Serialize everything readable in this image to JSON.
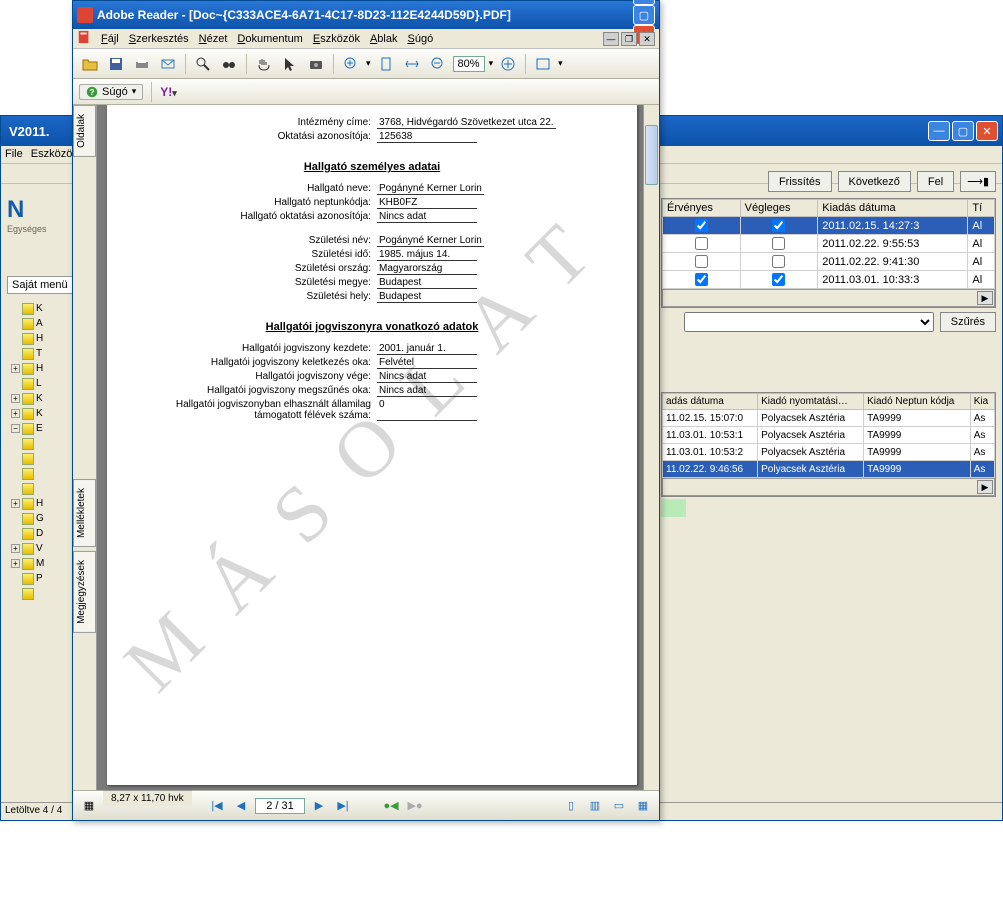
{
  "bg_window": {
    "title": "V2011.",
    "menu": [
      "File",
      "Eszközö"
    ],
    "logo_letter": "N",
    "logo_subtitle": "Egységes",
    "left_tab": "Saját menü",
    "tree_letters": [
      "K",
      "A",
      "H",
      "T",
      "H",
      "L",
      "K",
      "K",
      "E",
      "",
      "",
      "",
      "",
      "H",
      "G",
      "D",
      "V",
      "M",
      "P",
      ""
    ],
    "status": "Letöltve 4 / 4"
  },
  "top_buttons": {
    "refresh": "Frissítés",
    "next": "Következő",
    "up": "Fel",
    "pin_icon": "⟶▮"
  },
  "grid1": {
    "headers": [
      "Érvényes",
      "Végleges",
      "Kiadás dátuma",
      "Tí"
    ],
    "rows": [
      {
        "ervenyes": true,
        "vegleges": true,
        "datum": "2011.02.15. 14:27:3",
        "tip": "Al",
        "selected": true
      },
      {
        "ervenyes": false,
        "vegleges": false,
        "datum": "2011.02.22. 9:55:53",
        "tip": "Al",
        "selected": false
      },
      {
        "ervenyes": false,
        "vegleges": false,
        "datum": "2011.02.22. 9:41:30",
        "tip": "Al",
        "selected": false
      },
      {
        "ervenyes": true,
        "vegleges": true,
        "datum": "2011.03.01. 10:33:3",
        "tip": "Al",
        "selected": false
      }
    ]
  },
  "filter_button": "Szűrés",
  "grid2": {
    "headers": [
      "adás dátuma",
      "Kiadó nyomtatási…",
      "Kiadó Neptun kódja",
      "Kia"
    ],
    "rows": [
      {
        "datum": "11.02.15. 15:07:0",
        "nyomt": "Polyacsek Asztéria",
        "kod": "TA9999",
        "kia": "As",
        "selected": false
      },
      {
        "datum": "11.03.01. 10:53:1",
        "nyomt": "Polyacsek Asztéria",
        "kod": "TA9999",
        "kia": "As",
        "selected": false
      },
      {
        "datum": "11.03.01. 10:53:2",
        "nyomt": "Polyacsek Asztéria",
        "kod": "TA9999",
        "kia": "As",
        "selected": false
      },
      {
        "datum": "11.02.22. 9:46:56",
        "nyomt": "Polyacsek Asztéria",
        "kod": "TA9999",
        "kia": "As",
        "selected": true
      }
    ]
  },
  "pdf": {
    "title": "Adobe Reader - [Doc~{C333ACE4-6A71-4C17-8D23-112E4244D59D}.PDF]",
    "menu": [
      {
        "full": "Fájl",
        "u": "F",
        "rest": "ájl"
      },
      {
        "full": "Szerkesztés",
        "u": "S",
        "rest": "zerkesztés"
      },
      {
        "full": "Nézet",
        "u": "N",
        "rest": "ézet"
      },
      {
        "full": "Dokumentum",
        "u": "D",
        "rest": "okumentum"
      },
      {
        "full": "Eszközök",
        "u": "E",
        "rest": "szközök"
      },
      {
        "full": "Ablak",
        "u": "A",
        "rest": "blak"
      },
      {
        "full": "Súgó",
        "u": "S",
        "rest": "úgó"
      }
    ],
    "zoom": "80%",
    "help_label": "Súgó",
    "yahoo": "Y!",
    "side_tabs": [
      "Oldalak",
      "Mellékletek",
      "Megjegyzések"
    ],
    "page_dim": "8,27 x 11,70 hvk",
    "page_indicator": "2 / 31",
    "watermark": "MÁSOLAT"
  },
  "doc": {
    "top": [
      {
        "label": "Intézmény címe:",
        "value": "3768, Hidvégardó Szövetkezet utca 22."
      },
      {
        "label": "Oktatási azonosítója:",
        "value": "125638"
      }
    ],
    "section1": "Hallgató személyes adatai",
    "personal": [
      {
        "label": "Hallgató neve:",
        "value": "Pogányné Kerner Lorin"
      },
      {
        "label": "Hallgató neptunkódja:",
        "value": "KHB0FZ"
      },
      {
        "label": "Hallgató oktatási azonosítója:",
        "value": "Nincs adat"
      }
    ],
    "birth": [
      {
        "label": "Születési név:",
        "value": "Pogányné Kerner Lorin"
      },
      {
        "label": "Születési idő:",
        "value": "1985. május 14."
      },
      {
        "label": "Születési ország:",
        "value": "Magyarország"
      },
      {
        "label": "Születési megye:",
        "value": "Budapest"
      },
      {
        "label": "Születési hely:",
        "value": "Budapest"
      }
    ],
    "section2": "Hallgatói jogviszonyra vonatkozó adatok",
    "status": [
      {
        "label": "Hallgatói jogviszony kezdete:",
        "value": "2001. január 1."
      },
      {
        "label": "Hallgatói jogviszony keletkezés oka:",
        "value": "Felvétel"
      },
      {
        "label": "Hallgatói jogviszony vége:",
        "value": "Nincs adat"
      },
      {
        "label": "Hallgatói jogviszony megszűnés oka:",
        "value": "Nincs adat"
      },
      {
        "label": "Hallgatói jogviszonyban elhasznált államilag támogatott félévek száma:",
        "value": "0"
      }
    ]
  }
}
